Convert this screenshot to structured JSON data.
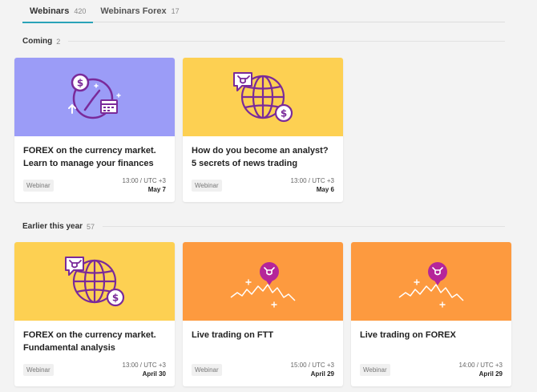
{
  "tabs": [
    {
      "label": "Webinars",
      "count": "420"
    },
    {
      "label": "Webinars Forex",
      "count": "17"
    }
  ],
  "sections": [
    {
      "title": "Coming",
      "count": "2"
    },
    {
      "title": "Earlier this year",
      "count": "57"
    }
  ],
  "cards": [
    {
      "title": "FOREX on the currency market. Learn to manage your finances",
      "badge": "Webinar",
      "time": "13:00 / UTC +3",
      "date": "May 7",
      "banner_color": "#9b9cf7",
      "icon": "clock-dollar-calendar-icon"
    },
    {
      "title": "How do you become an analyst? 5 secrets of news trading",
      "badge": "Webinar",
      "time": "13:00 / UTC +3",
      "date": "May 6",
      "banner_color": "#fdd052",
      "icon": "globe-bull-dollar-icon"
    },
    {
      "title": "FOREX on the currency market. Fundamental analysis",
      "badge": "Webinar",
      "time": "13:00 / UTC +3",
      "date": "April 30",
      "banner_color": "#fdd052",
      "icon": "globe-bull-dollar-icon"
    },
    {
      "title": "Live trading on FTT",
      "badge": "Webinar",
      "time": "15:00 / UTC +3",
      "date": "April 29",
      "banner_color": "#fd9a3f",
      "icon": "bull-pin-chart-icon"
    },
    {
      "title": "Live trading on FOREX",
      "badge": "Webinar",
      "time": "14:00 / UTC +3",
      "date": "April 29",
      "banner_color": "#fd9a3f",
      "icon": "bull-pin-chart-icon"
    }
  ],
  "colors": {
    "accent": "#2aa3b8",
    "icon_stroke": "#7a2a9a"
  }
}
